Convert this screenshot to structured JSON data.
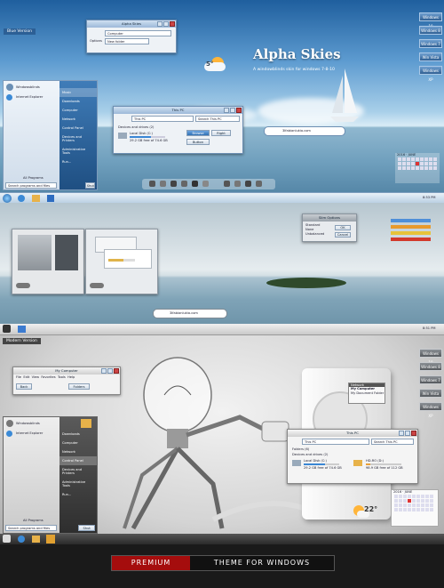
{
  "header": {
    "title": "Alpha Skies",
    "subtitle": "A windowblinds skin for windows 7-8-10",
    "blue_label": "Blue Version",
    "modern_label": "Modern Version"
  },
  "side_buttons": [
    "Windows 10",
    "Windows 8",
    "Windows 7",
    "Win Vista",
    "Windows XP"
  ],
  "panel1": {
    "top_window": {
      "title": "Alpha Skies",
      "field_label": "Computer",
      "button_label": "Options",
      "value": "New folder"
    },
    "start_menu": {
      "user": "Windowsblinds",
      "pinned": "Internet Explorer",
      "all_programs": "All Programs",
      "search_placeholder": "Search programs and files",
      "shutdown": "Shut down",
      "right_items": [
        "Music",
        "Downloads",
        "Computer",
        "Network",
        "Control Panel",
        "Devices and Printers",
        "Administrative Tools",
        "Run..."
      ]
    },
    "explorer": {
      "title": "This PC",
      "path": "This PC",
      "search": "Search This PC",
      "section": "Devices and drives (2)",
      "drive": "Local Disk (C:)",
      "drive_free": "29.2 GB free of 74.6 GB",
      "buttons": [
        "Browse",
        "Right",
        "Button"
      ]
    },
    "search_bar": "3lfabianlukia.com",
    "weather_temp": "5°",
    "calendar_title": "2016 · JUNE",
    "clock": "8:53 PM"
  },
  "panel2": {
    "dialog": {
      "title": "Slim Options",
      "options": [
        "Standard",
        "None",
        "Unbalanced"
      ],
      "ok": "OK",
      "cancel": "Cancel"
    },
    "search_bar": "3lfabianlukia.com"
  },
  "panel3": {
    "explorer_small": {
      "title": "My Computer",
      "menu": [
        "File",
        "Edit",
        "View",
        "Favorites",
        "Tools",
        "Help"
      ],
      "back": "Back",
      "folders": "Folders"
    },
    "notif": {
      "title": "Network",
      "line1": "My Computer",
      "line2": "My Document Folder"
    },
    "start_menu": {
      "user": "Windowsblinds",
      "pinned": "Internet Explorer",
      "all_programs": "All Programs",
      "search_placeholder": "Search programs and files",
      "shutdown": "Shut down",
      "right_items": [
        "Downloads",
        "Computer",
        "Network",
        "Control Panel",
        "Devices and Printers",
        "Administrative Tools",
        "Run..."
      ]
    },
    "explorer": {
      "title": "This PC",
      "path": "This PC",
      "search": "Search This PC",
      "sec1": "Folders (6)",
      "sec2": "Devices and drives (2)",
      "drive1": "Local Disk (C:)",
      "drive1_free": "29.2 GB free of 74.6 GB",
      "drive2": "HD-RO (D:)",
      "drive2_free": "98.9 GB free of 112 GB"
    },
    "weather_temp": "22°",
    "calendar_title": "2016 · JUNE",
    "clock": "8:51 PM"
  },
  "footer": {
    "left": "PREMIUM",
    "right": "THEME FOR WINDOWS"
  }
}
